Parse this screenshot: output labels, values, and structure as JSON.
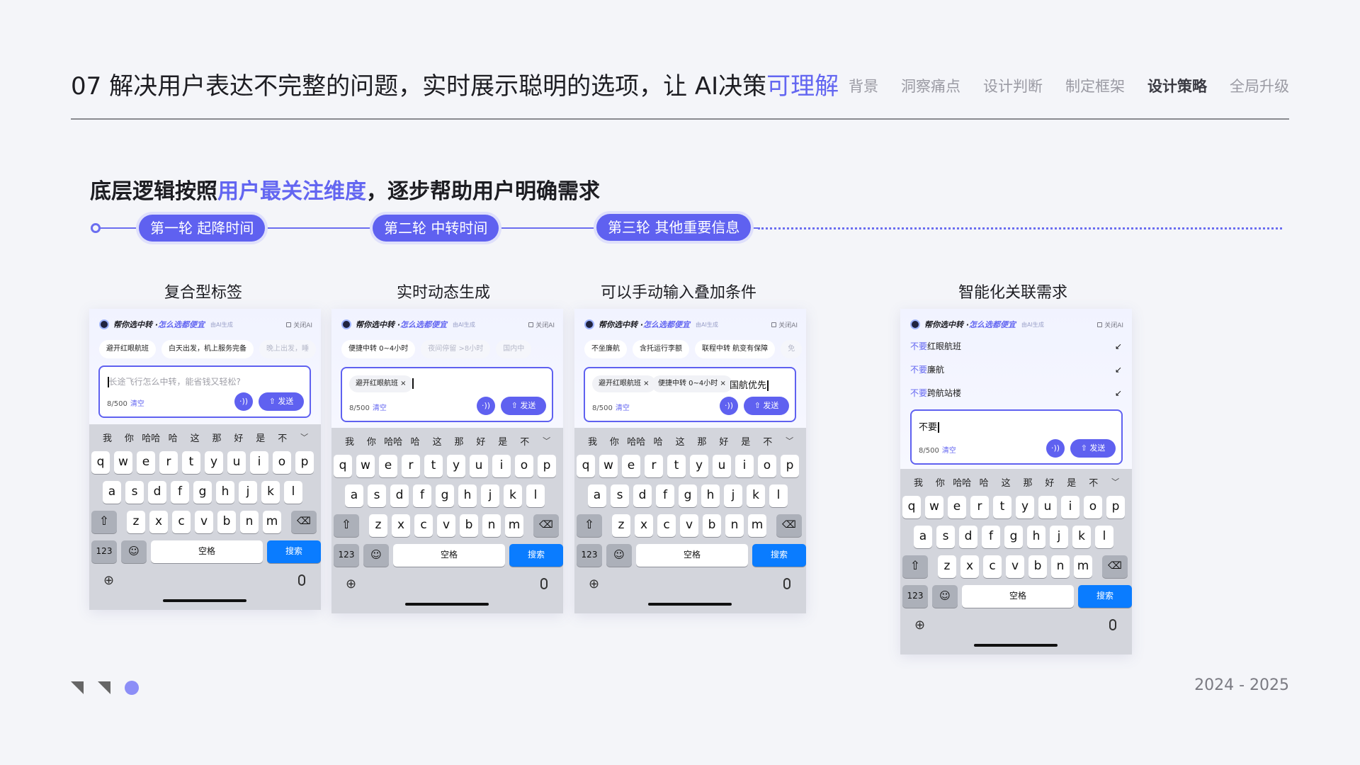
{
  "header": {
    "title_prefix": "07 解决用户表达不完整的问题，实时展示聪明的选项，让 AI决策",
    "title_accent": "可理解",
    "nav": [
      "背景",
      "洞察痛点",
      "设计判断",
      "制定框架",
      "设计策略",
      "全局升级"
    ],
    "nav_active": "设计策略"
  },
  "subtitle": {
    "part1": "底层逻辑按照",
    "accent": "用户最关注维度",
    "part2": "，逐步帮助用户明确需求"
  },
  "timeline": [
    "第一轮 起降时间",
    "第二轮 中转时间",
    "第三轮 其他重要信息"
  ],
  "columns": [
    "复合型标签",
    "实时动态生成",
    "可以手动输入叠加条件",
    "智能化关联需求"
  ],
  "phone": {
    "bar_title1": "帮你选中转 · ",
    "bar_title2": "怎么选都便宜",
    "bar_tag": "由AI生成",
    "close_ai": "关闭AI",
    "count": "8/500",
    "clear": "清空",
    "send": "发送",
    "mic_symbol": "·))",
    "keyboard": {
      "candidates": [
        "我",
        "你",
        "哈哈",
        "哈",
        "这",
        "那",
        "好",
        "是",
        "不"
      ],
      "row1": [
        "q",
        "w",
        "e",
        "r",
        "t",
        "y",
        "u",
        "i",
        "o",
        "p"
      ],
      "row2": [
        "a",
        "s",
        "d",
        "f",
        "g",
        "h",
        "j",
        "k",
        "l"
      ],
      "row3": [
        "z",
        "x",
        "c",
        "v",
        "b",
        "n",
        "m"
      ],
      "num": "123",
      "space": "空格",
      "search": "搜索"
    }
  },
  "phones": [
    {
      "chips": [
        "避开红眼航班",
        "白天出发，机上服务完备",
        "晚上出发，睡"
      ],
      "placeholder": "长途飞行怎么中转，能省钱又轻松?"
    },
    {
      "chips": [
        "便捷中转 0~4小时",
        "夜间停留 >8小时",
        "国内中"
      ],
      "tags": [
        "避开红眼航班 ×"
      ]
    },
    {
      "chips": [
        "不坐廉航",
        "含托运行李额",
        "联程中转 航变有保障",
        "免"
      ],
      "tags": [
        "避开红眼航班 ×",
        "便捷中转 0~4小时 ×"
      ],
      "typed": "国航优先"
    },
    {
      "suggestions": [
        {
          "neg": "不要",
          "text": "红眼航班"
        },
        {
          "neg": "不要",
          "text": "廉航"
        },
        {
          "neg": "不要",
          "text": "跨航站楼"
        }
      ],
      "typed": "不要"
    }
  ],
  "footer": {
    "years": "2024  -  2025",
    "icons": [
      "corner-mark-icon",
      "corner-mark-icon",
      "dot-icon"
    ]
  }
}
